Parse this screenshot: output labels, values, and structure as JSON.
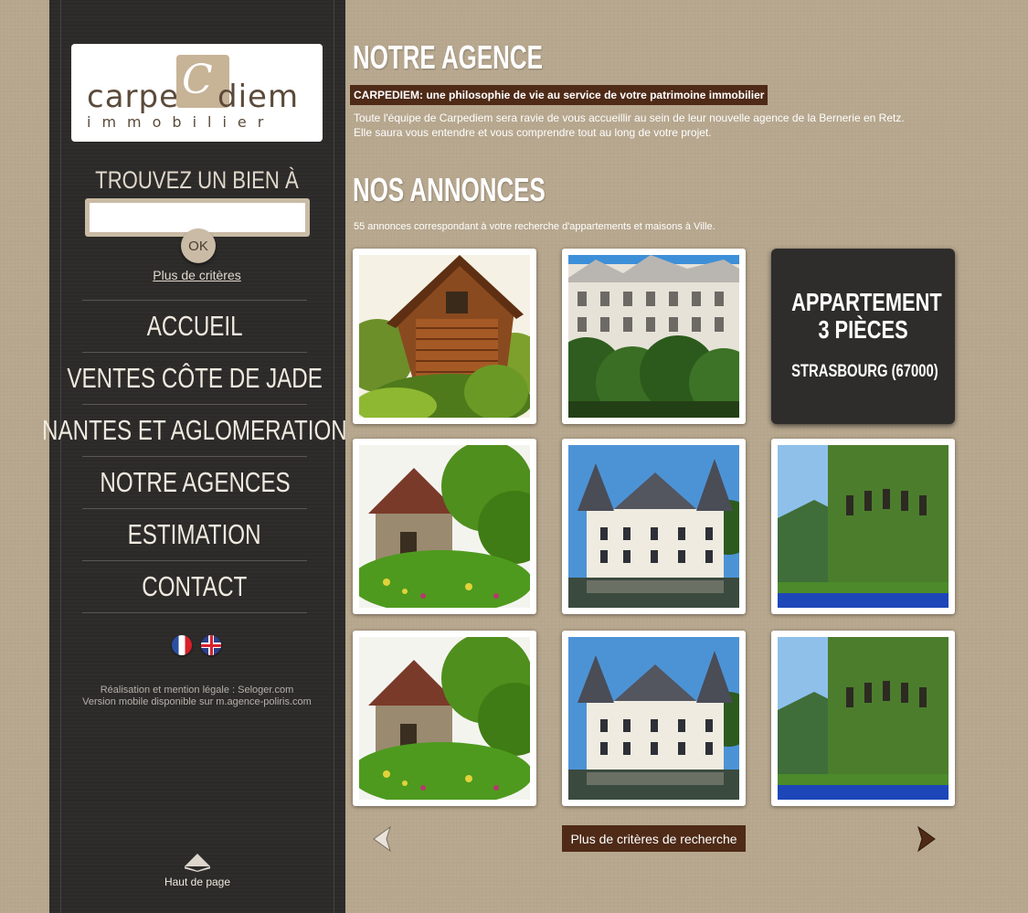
{
  "logo": {
    "top_left": "carpe",
    "mark": "C",
    "top_right": "diem",
    "bottom": "immobilier"
  },
  "search": {
    "title": "TROUVEZ UN BIEN À",
    "value": "",
    "ok_label": "OK",
    "more_criteria": "Plus de critères"
  },
  "nav": {
    "items": [
      "ACCUEIL",
      "VENTES CÔTE DE JADE",
      "NANTES ET AGLOMERATION",
      "NOTRE AGENCES",
      "ESTIMATION",
      "CONTACT"
    ]
  },
  "credits": {
    "line1": "Réalisation et mention légale : Seloger.com",
    "line2": "Version mobile disponible sur m.agence-poliris.com"
  },
  "back_to_top": "Haut de page",
  "agency": {
    "title": "NOTRE AGENCE",
    "tagline": "CARPEDIEM: une philosophie de vie au service de votre patrimoine immobilier",
    "desc_line1": "Toute l'équipe de Carpediem sera ravie de vous accueillir au sein de leur nouvelle agence de la Bernerie en Retz.",
    "desc_line2": "Elle saura vous entendre et vous comprendre tout au long de votre projet."
  },
  "listings": {
    "title": "NOS ANNONCES",
    "count_text": "55 annonces correspondant à votre recherche d'appartements et maisons à Ville.",
    "info_card": {
      "type_line1": "APPARTEMENT",
      "type_line2": "3 PIÈCES",
      "city": "STRASBOURG (67000)"
    },
    "more_button": "Plus de critères de recherche"
  },
  "colors": {
    "accent": "#4e2a17",
    "sidebar": "#2b2a29",
    "background": "#b6a68d",
    "button_beige": "#c9bba5"
  }
}
